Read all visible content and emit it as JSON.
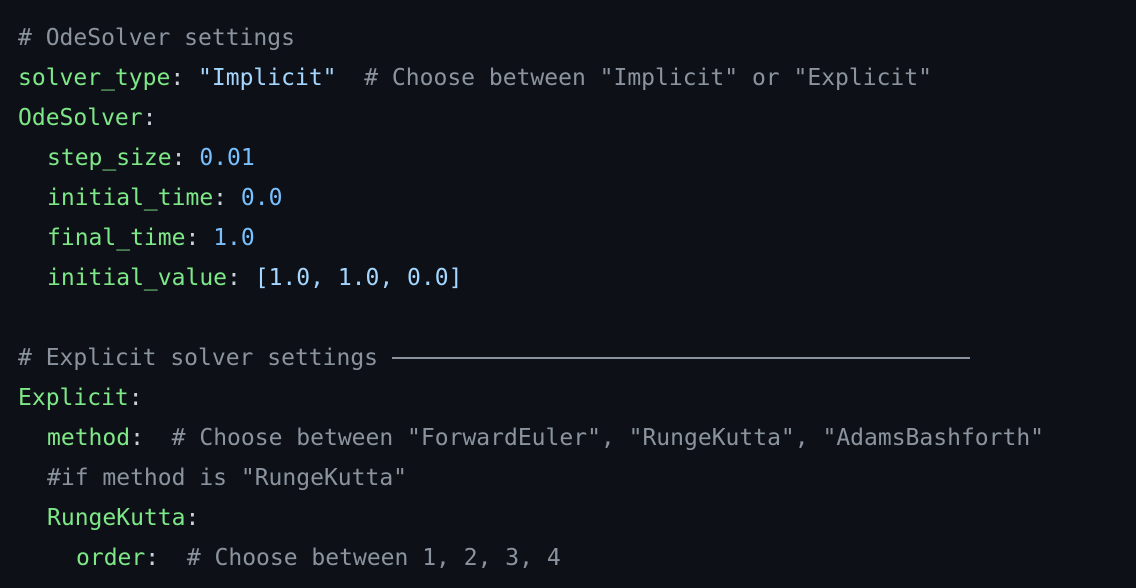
{
  "editor": {
    "language": "yaml",
    "colors": {
      "background": "#0d1117",
      "key": "#7ee787",
      "string": "#a5d6ff",
      "number": "#79c0ff",
      "comment": "#8b949e",
      "text": "#c9d1d9"
    },
    "lines": {
      "l1": {
        "comment": "# OdeSolver settings"
      },
      "l2": {
        "key": "solver_type",
        "colon": ":",
        "value": "\"Implicit\"",
        "comment": "# Choose between \"Implicit\" or \"Explicit\""
      },
      "l3": {
        "key": "OdeSolver",
        "colon": ":"
      },
      "l4": {
        "key": "step_size",
        "colon": ":",
        "value": "0.01"
      },
      "l5": {
        "key": "initial_time",
        "colon": ":",
        "value": "0.0"
      },
      "l6": {
        "key": "final_time",
        "colon": ":",
        "value": "1.0"
      },
      "l7": {
        "key": "initial_value",
        "colon": ":",
        "value": "[1.0, 1.0, 0.0]"
      },
      "l9": {
        "comment": "# Explicit solver settings"
      },
      "l10": {
        "key": "Explicit",
        "colon": ":"
      },
      "l11": {
        "key": "method",
        "colon": ":",
        "comment": "# Choose between \"ForwardEuler\", \"RungeKutta\", \"AdamsBashforth\""
      },
      "l12": {
        "comment": "#if method is \"RungeKutta\""
      },
      "l13": {
        "key": "RungeKutta",
        "colon": ":"
      },
      "l14": {
        "key": "order",
        "colon": ":",
        "comment": "# Choose between 1, 2, 3, 4"
      }
    }
  }
}
